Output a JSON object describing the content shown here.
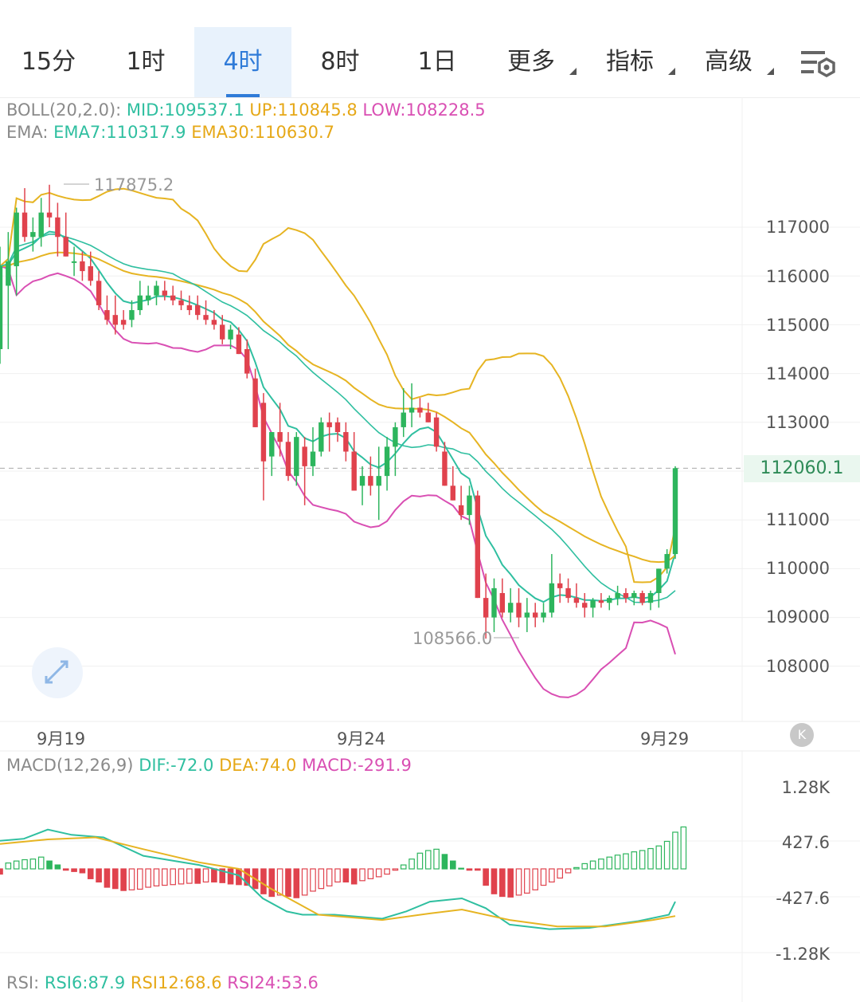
{
  "tabs": [
    {
      "label": "15分",
      "active": false
    },
    {
      "label": "1时",
      "active": false
    },
    {
      "label": "4时",
      "active": true
    },
    {
      "label": "8时",
      "active": false
    },
    {
      "label": "1日",
      "active": false
    },
    {
      "label": "更多",
      "active": false,
      "dropdown": true
    },
    {
      "label": "指标",
      "active": false,
      "dropdown": true
    },
    {
      "label": "高级",
      "active": false,
      "dropdown": true
    }
  ],
  "settings_icon": "chart-settings-icon",
  "boll": {
    "name": "BOLL(20,2.0):",
    "mid": "MID:109537.1",
    "up": "UP:110845.8",
    "low": "LOW:108228.5"
  },
  "ema": {
    "name": "EMA:",
    "ema7": "EMA7:110317.9",
    "ema30": "EMA30:110630.7"
  },
  "macd": {
    "name": "MACD(12,26,9)",
    "dif": "DIF:-72.0",
    "dea": "DEA:74.0",
    "macd": "MACD:-291.9"
  },
  "rsi": {
    "name": "RSI:",
    "rsi6": "RSI6:87.9",
    "rsi12": "RSI12:68.6",
    "rsi24": "RSI24:53.6"
  },
  "colors": {
    "up": "#2db55d",
    "down": "#e0424d",
    "mid": "#2fbfa0",
    "band": "#e6b422",
    "low": "#d94fb3",
    "accent": "#2f7bd8"
  },
  "price_axis": [
    "117000",
    "116000",
    "115000",
    "114000",
    "113000",
    "111000",
    "110000",
    "109000",
    "108000"
  ],
  "macd_axis": [
    "1.28K",
    "427.6",
    "-427.6",
    "-1.28K"
  ],
  "x_axis": [
    "9月19",
    "9月24",
    "9月29"
  ],
  "current_price": "112060.1",
  "high_label": "117875.2",
  "low_label": "108566.0",
  "chart_data": {
    "type": "candlestick",
    "candles": [
      {
        "o": 114500,
        "h": 116600,
        "l": 114200,
        "c": 116200
      },
      {
        "o": 115800,
        "h": 116900,
        "l": 114500,
        "c": 116300
      },
      {
        "o": 116200,
        "h": 117400,
        "l": 115600,
        "c": 117300
      },
      {
        "o": 117300,
        "h": 117800,
        "l": 116700,
        "c": 116800
      },
      {
        "o": 116800,
        "h": 117200,
        "l": 116500,
        "c": 116900
      },
      {
        "o": 116800,
        "h": 117600,
        "l": 116600,
        "c": 117300
      },
      {
        "o": 117300,
        "h": 117870,
        "l": 117000,
        "c": 117200
      },
      {
        "o": 117200,
        "h": 117500,
        "l": 116400,
        "c": 116800
      },
      {
        "o": 116800,
        "h": 117300,
        "l": 116400,
        "c": 116400
      },
      {
        "o": 116300,
        "h": 116600,
        "l": 116000,
        "c": 116300
      },
      {
        "o": 116300,
        "h": 116500,
        "l": 115900,
        "c": 116100
      },
      {
        "o": 116200,
        "h": 116500,
        "l": 115800,
        "c": 115900
      },
      {
        "o": 115900,
        "h": 116100,
        "l": 115300,
        "c": 115400
      },
      {
        "o": 115300,
        "h": 115600,
        "l": 115000,
        "c": 115100
      },
      {
        "o": 115200,
        "h": 115600,
        "l": 114800,
        "c": 115000
      },
      {
        "o": 115100,
        "h": 115300,
        "l": 114900,
        "c": 115000
      },
      {
        "o": 115100,
        "h": 115500,
        "l": 114950,
        "c": 115300
      },
      {
        "o": 115300,
        "h": 115900,
        "l": 115200,
        "c": 115600
      },
      {
        "o": 115500,
        "h": 115800,
        "l": 115400,
        "c": 115600
      },
      {
        "o": 115600,
        "h": 115900,
        "l": 115400,
        "c": 115800
      },
      {
        "o": 115700,
        "h": 115900,
        "l": 115500,
        "c": 115600
      },
      {
        "o": 115600,
        "h": 115800,
        "l": 115400,
        "c": 115500
      },
      {
        "o": 115500,
        "h": 115700,
        "l": 115300,
        "c": 115400
      },
      {
        "o": 115400,
        "h": 115600,
        "l": 115200,
        "c": 115300
      },
      {
        "o": 115400,
        "h": 115600,
        "l": 115100,
        "c": 115200
      },
      {
        "o": 115200,
        "h": 115500,
        "l": 115000,
        "c": 115100
      },
      {
        "o": 115100,
        "h": 115300,
        "l": 114900,
        "c": 115000
      },
      {
        "o": 115000,
        "h": 115200,
        "l": 114600,
        "c": 114700
      },
      {
        "o": 114700,
        "h": 115000,
        "l": 114500,
        "c": 114900
      },
      {
        "o": 114800,
        "h": 114950,
        "l": 114400,
        "c": 114400
      },
      {
        "o": 114500,
        "h": 114700,
        "l": 113900,
        "c": 114000
      },
      {
        "o": 113900,
        "h": 114100,
        "l": 112900,
        "c": 112900
      },
      {
        "o": 113400,
        "h": 113600,
        "l": 111400,
        "c": 112200
      },
      {
        "o": 112300,
        "h": 112800,
        "l": 111900,
        "c": 112800
      },
      {
        "o": 112800,
        "h": 113400,
        "l": 112300,
        "c": 112600
      },
      {
        "o": 112600,
        "h": 112800,
        "l": 111800,
        "c": 111900
      },
      {
        "o": 111900,
        "h": 112800,
        "l": 111700,
        "c": 112700
      },
      {
        "o": 112500,
        "h": 112700,
        "l": 111300,
        "c": 112100
      },
      {
        "o": 112100,
        "h": 112900,
        "l": 111900,
        "c": 112400
      },
      {
        "o": 112400,
        "h": 113100,
        "l": 112300,
        "c": 113000
      },
      {
        "o": 113000,
        "h": 113200,
        "l": 112400,
        "c": 112900
      },
      {
        "o": 113000,
        "h": 113100,
        "l": 112600,
        "c": 112800
      },
      {
        "o": 112800,
        "h": 113000,
        "l": 112200,
        "c": 112400
      },
      {
        "o": 112400,
        "h": 112800,
        "l": 111600,
        "c": 111600
      },
      {
        "o": 111700,
        "h": 112100,
        "l": 111300,
        "c": 111900
      },
      {
        "o": 111900,
        "h": 112300,
        "l": 111500,
        "c": 111700
      },
      {
        "o": 111700,
        "h": 112500,
        "l": 111000,
        "c": 111900
      },
      {
        "o": 111900,
        "h": 112700,
        "l": 111600,
        "c": 112500
      },
      {
        "o": 112500,
        "h": 113000,
        "l": 111900,
        "c": 112900
      },
      {
        "o": 112900,
        "h": 113700,
        "l": 112700,
        "c": 113200
      },
      {
        "o": 113200,
        "h": 113800,
        "l": 112900,
        "c": 113300
      },
      {
        "o": 113300,
        "h": 113500,
        "l": 113100,
        "c": 113200
      },
      {
        "o": 113200,
        "h": 113400,
        "l": 113000,
        "c": 113000
      },
      {
        "o": 113100,
        "h": 113200,
        "l": 112400,
        "c": 112500
      },
      {
        "o": 112400,
        "h": 112600,
        "l": 111700,
        "c": 111700
      },
      {
        "o": 111700,
        "h": 112100,
        "l": 111400,
        "c": 111400
      },
      {
        "o": 111300,
        "h": 111700,
        "l": 111000,
        "c": 111100
      },
      {
        "o": 111100,
        "h": 111700,
        "l": 110900,
        "c": 111500
      },
      {
        "o": 111500,
        "h": 111600,
        "l": 109400,
        "c": 109400
      },
      {
        "o": 109400,
        "h": 109900,
        "l": 108566,
        "c": 109000
      },
      {
        "o": 109000,
        "h": 109800,
        "l": 108700,
        "c": 109600
      },
      {
        "o": 109500,
        "h": 109800,
        "l": 109000,
        "c": 109100
      },
      {
        "o": 109100,
        "h": 109600,
        "l": 108900,
        "c": 109300
      },
      {
        "o": 109300,
        "h": 109600,
        "l": 108800,
        "c": 109000
      },
      {
        "o": 109000,
        "h": 109400,
        "l": 108700,
        "c": 109100
      },
      {
        "o": 109100,
        "h": 109300,
        "l": 108800,
        "c": 109000
      },
      {
        "o": 109000,
        "h": 109300,
        "l": 108900,
        "c": 109100
      },
      {
        "o": 109100,
        "h": 110300,
        "l": 109000,
        "c": 109700
      },
      {
        "o": 109700,
        "h": 109900,
        "l": 109300,
        "c": 109600
      },
      {
        "o": 109600,
        "h": 109800,
        "l": 109300,
        "c": 109400
      },
      {
        "o": 109400,
        "h": 109700,
        "l": 109200,
        "c": 109300
      },
      {
        "o": 109300,
        "h": 109500,
        "l": 109000,
        "c": 109200
      },
      {
        "o": 109200,
        "h": 109400,
        "l": 109000,
        "c": 109350
      },
      {
        "o": 109350,
        "h": 109500,
        "l": 109200,
        "c": 109300
      },
      {
        "o": 109300,
        "h": 109450,
        "l": 109150,
        "c": 109400
      },
      {
        "o": 109400,
        "h": 109650,
        "l": 109250,
        "c": 109500
      },
      {
        "o": 109500,
        "h": 109600,
        "l": 109300,
        "c": 109400
      },
      {
        "o": 109400,
        "h": 109550,
        "l": 109250,
        "c": 109500
      },
      {
        "o": 109500,
        "h": 109550,
        "l": 109250,
        "c": 109300
      },
      {
        "o": 109300,
        "h": 109550,
        "l": 109150,
        "c": 109500
      },
      {
        "o": 109500,
        "h": 110000,
        "l": 109200,
        "c": 110000
      },
      {
        "o": 110000,
        "h": 110400,
        "l": 109900,
        "c": 110300
      },
      {
        "o": 110300,
        "h": 112100,
        "l": 110200,
        "c": 112060
      }
    ],
    "macd_hist": [
      -80,
      90,
      120,
      140,
      150,
      180,
      120,
      60,
      -20,
      -40,
      -60,
      -150,
      -200,
      -280,
      -300,
      -330,
      -320,
      -310,
      -280,
      -260,
      -250,
      -240,
      -230,
      -220,
      -220,
      -200,
      -200,
      -210,
      -230,
      -240,
      -250,
      -300,
      -380,
      -420,
      -400,
      -420,
      -440,
      -400,
      -340,
      -300,
      -260,
      -200,
      -200,
      -230,
      -180,
      -150,
      -120,
      -80,
      -20,
      60,
      150,
      240,
      280,
      300,
      220,
      120,
      10,
      -20,
      -20,
      -250,
      -380,
      -420,
      -430,
      -400,
      -370,
      -320,
      -250,
      -200,
      -140,
      -60,
      20,
      80,
      120,
      150,
      180,
      210,
      230,
      260,
      280,
      310,
      350,
      420,
      560,
      640
    ],
    "dif_points": [
      [
        0,
        430
      ],
      [
        30,
        460
      ],
      [
        60,
        600
      ],
      [
        90,
        520
      ],
      [
        130,
        480
      ],
      [
        180,
        200
      ],
      [
        250,
        60
      ],
      [
        300,
        -100
      ],
      [
        330,
        -450
      ],
      [
        360,
        -650
      ],
      [
        380,
        -700
      ],
      [
        420,
        -700
      ],
      [
        480,
        -760
      ],
      [
        510,
        -650
      ],
      [
        540,
        -500
      ],
      [
        580,
        -450
      ],
      [
        610,
        -600
      ],
      [
        640,
        -850
      ],
      [
        690,
        -920
      ],
      [
        740,
        -900
      ],
      [
        800,
        -800
      ],
      [
        840,
        -700
      ],
      [
        848,
        -500
      ]
    ],
    "dea_points": [
      [
        0,
        380
      ],
      [
        60,
        450
      ],
      [
        120,
        480
      ],
      [
        180,
        300
      ],
      [
        250,
        100
      ],
      [
        300,
        0
      ],
      [
        340,
        -300
      ],
      [
        400,
        -700
      ],
      [
        480,
        -780
      ],
      [
        540,
        -680
      ],
      [
        580,
        -620
      ],
      [
        640,
        -780
      ],
      [
        700,
        -880
      ],
      [
        760,
        -880
      ],
      [
        820,
        -780
      ],
      [
        848,
        -720
      ]
    ]
  }
}
